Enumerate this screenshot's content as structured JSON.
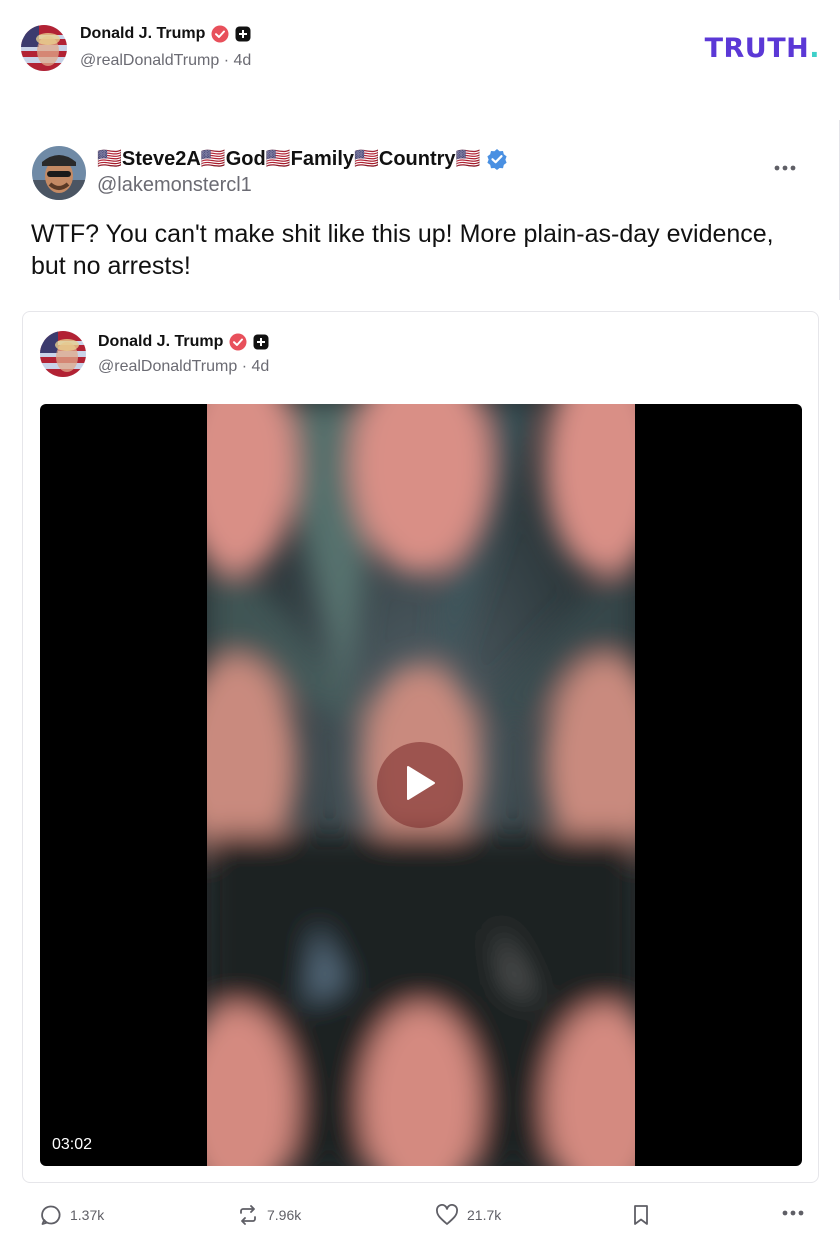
{
  "header": {
    "author_name": "Donald J. Trump",
    "author_handle": "@realDonaldTrump",
    "time": "4d",
    "separator": "·",
    "logo_text": "TRUTH",
    "logo_dot": "."
  },
  "post": {
    "author_display": "🇺🇸Steve2A🇺🇸God🇺🇸Family🇺🇸Country🇺🇸",
    "author_handle": "@lakemonstercl1",
    "text": "WTF? You can't make shit like this up! More plain-as-day evidence, but no arrests!",
    "more_icon": "more-horizontal-icon"
  },
  "quoted": {
    "author_name": "Donald J. Trump",
    "author_handle": "@realDonaldTrump",
    "time": "4d",
    "separator": "·",
    "video_duration": "03:02"
  },
  "actions": {
    "replies": "1.37k",
    "reposts": "7.96k",
    "likes": "21.7k"
  },
  "colors": {
    "brand": "#5b38d6",
    "brand_dot": "#3fd0c9",
    "verified_red": "#e8505b",
    "verified_blue": "#4a90e2",
    "muted": "#6b6b73"
  }
}
